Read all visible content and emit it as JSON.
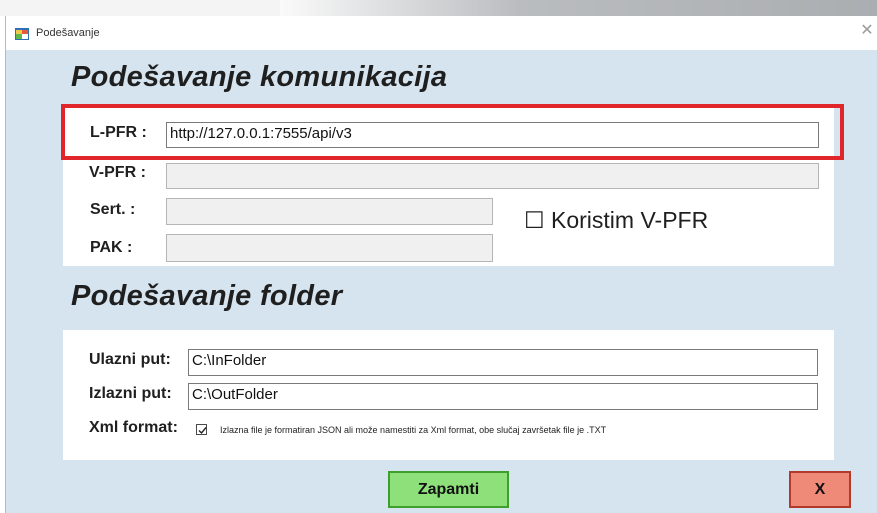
{
  "window": {
    "title": "Podešavanje"
  },
  "communication": {
    "heading": "Podešavanje komunikacija",
    "lpfr_label": "L-PFR :",
    "lpfr_value": "http://127.0.0.1:7555/api/v3",
    "vpfr_label": "V-PFR :",
    "vpfr_value": "",
    "sert_label": "Sert. :",
    "sert_value": "",
    "pak_label": "PAK :",
    "pak_value": "",
    "use_vpfr_glyph": "☐",
    "use_vpfr_label": "Koristim V-PFR",
    "use_vpfr_checked": false
  },
  "folder": {
    "heading": "Podešavanje folder",
    "input_label": "Ulazni put:",
    "input_value": "C:\\InFolder",
    "output_label": "Izlazni put:",
    "output_value": "C:\\OutFolder",
    "xml_label": "Xml format:",
    "xml_checked": true,
    "xml_note": "Izlazna file je formatiran JSON ali može namestiti za Xml format, obe slučaj završetak file je .TXT"
  },
  "buttons": {
    "save_label": "Zapamti",
    "close_label": "X"
  },
  "colors": {
    "highlight": "#e0252b",
    "save_button": "#8ee07a",
    "close_button": "#f08a78",
    "client_background": "#d6e4ef"
  }
}
